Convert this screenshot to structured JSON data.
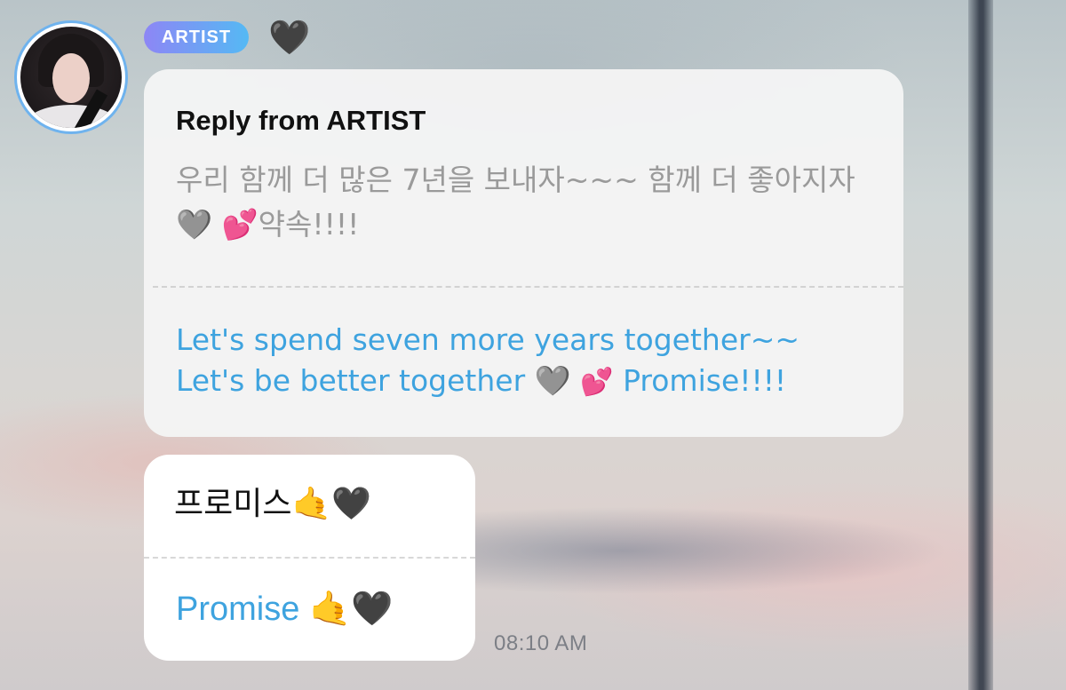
{
  "sender": {
    "badge": "ARTIST",
    "reaction": "🖤",
    "avatar_icon": "profile-photo"
  },
  "reply": {
    "title": "Reply from ARTIST",
    "original_ko": "우리 함께 더 많은 7년을 보내자~~~ 함께 더 좋아지자🩶 💕약속!!!!",
    "translation_en_line1": "Let's spend seven more years together~~",
    "translation_en_line2_text": "Let's be better together ",
    "translation_en_heart_grey": "🩶",
    "translation_en_heart_pink": "💕",
    "translation_en_line2_end": "Promise!!!!"
  },
  "message": {
    "text_ko": "프로미스🤙🖤",
    "text_en": "Promise",
    "emoji_hand": "🤙",
    "emoji_heart": "🖤"
  },
  "timestamp": "08:10 AM",
  "colors": {
    "badge_gradient_start": "#8d86f5",
    "badge_gradient_end": "#55b9f4",
    "translation_text": "#3ea3df",
    "original_text": "#9a9a9a",
    "avatar_ring": "#6fb3ee"
  }
}
